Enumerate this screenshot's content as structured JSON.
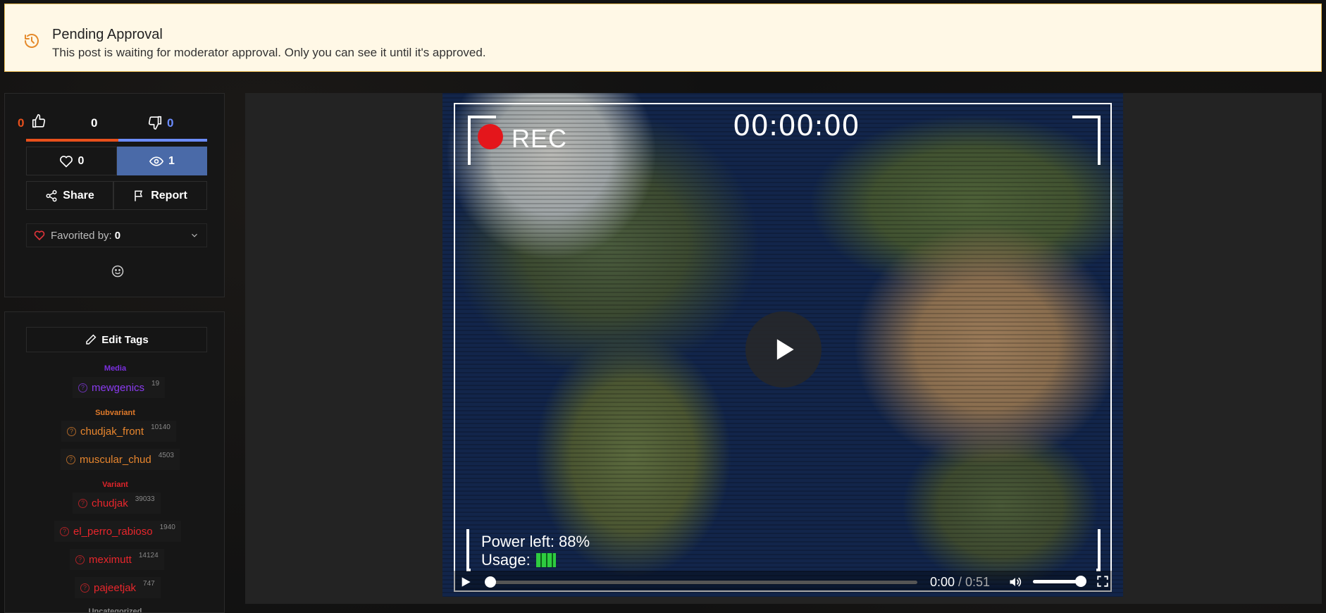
{
  "banner": {
    "title": "Pending Approval",
    "text": "This post is waiting for moderator approval. Only you can see it until it's approved.",
    "bg_color": "#fff8e6",
    "accent_color": "#e58a2b",
    "icon": "history-icon"
  },
  "votes": {
    "up_count": "0",
    "score": "0",
    "down_count": "0",
    "up_color": "#e8501c",
    "down_color": "#6b8cff"
  },
  "actions": {
    "favorites": "0",
    "views": "1",
    "share": "Share",
    "report": "Report"
  },
  "favorited_by": {
    "label": "Favorited by:",
    "count": "0"
  },
  "tags": {
    "edit_label": "Edit Tags",
    "groups": [
      {
        "label": "Media",
        "color": "#7b2fe0",
        "items": [
          {
            "name": "mewgenics",
            "count": "19"
          }
        ]
      },
      {
        "label": "Subvariant",
        "color": "#e07a2a",
        "items": [
          {
            "name": "chudjak_front",
            "count": "10140"
          },
          {
            "name": "muscular_chud",
            "count": "4503"
          }
        ]
      },
      {
        "label": "Variant",
        "color": "#e0242a",
        "items": [
          {
            "name": "chudjak",
            "count": "39033"
          },
          {
            "name": "el_perro_rabioso",
            "count": "1940"
          },
          {
            "name": "meximutt",
            "count": "14124"
          },
          {
            "name": "pajeetjak",
            "count": "747"
          }
        ]
      },
      {
        "label": "Uncategorized",
        "color": "#888888",
        "items": []
      }
    ]
  },
  "video": {
    "rec_label": "REC",
    "timecode": "00:00:00",
    "power": "Power left: 88%",
    "usage": "Usage:",
    "time_current": "0:00",
    "time_duration": "/ 0:51",
    "progress": 0.0,
    "volume": 0.85
  }
}
